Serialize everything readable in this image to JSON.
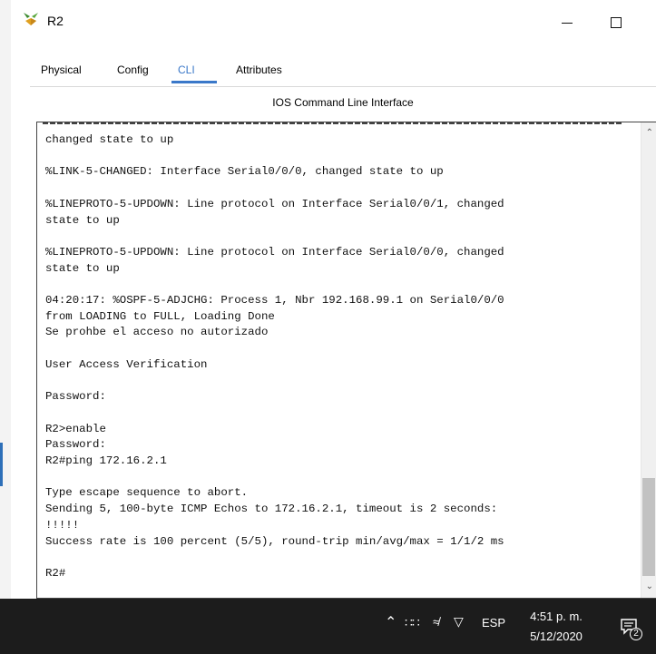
{
  "window": {
    "title": "R2"
  },
  "tabs": [
    {
      "label": "Physical"
    },
    {
      "label": "Config"
    },
    {
      "label": "CLI"
    },
    {
      "label": "Attributes"
    }
  ],
  "active_tab": "CLI",
  "panel_title": "IOS Command Line Interface",
  "console": {
    "lines": [
      "changed state to up",
      "",
      "%LINK-5-CHANGED: Interface Serial0/0/0, changed state to up",
      "",
      "%LINEPROTO-5-UPDOWN: Line protocol on Interface Serial0/0/1, changed",
      "state to up",
      "",
      "%LINEPROTO-5-UPDOWN: Line protocol on Interface Serial0/0/0, changed",
      "state to up",
      "",
      "04:20:17: %OSPF-5-ADJCHG: Process 1, Nbr 192.168.99.1 on Serial0/0/0",
      "from LOADING to FULL, Loading Done",
      "Se prohbe el acceso no autorizado",
      "",
      "User Access Verification",
      "",
      "Password:",
      "",
      "R2>enable",
      "Password:",
      "R2#ping 172.16.2.1",
      "",
      "Type escape sequence to abort.",
      "Sending 5, 100-byte ICMP Echos to 172.16.2.1, timeout is 2 seconds:",
      "!!!!!",
      "Success rate is 100 percent (5/5), round-trip min/avg/max = 1/1/2 ms",
      "",
      "R2#"
    ]
  },
  "taskbar": {
    "language": "ESP",
    "time": "4:51 p. m.",
    "date": "5/12/2020",
    "notification_count": "2"
  },
  "icons": {
    "app": "packet-tracer-router-icon",
    "tray": [
      "chevron-up-icon",
      "network-icon",
      "wifi-icon",
      "volume-icon"
    ],
    "notification": "action-center-icon"
  },
  "colors": {
    "active_tab": "#3a78c9",
    "taskbar_bg": "#1c1c1c",
    "console_text": "#111111"
  }
}
